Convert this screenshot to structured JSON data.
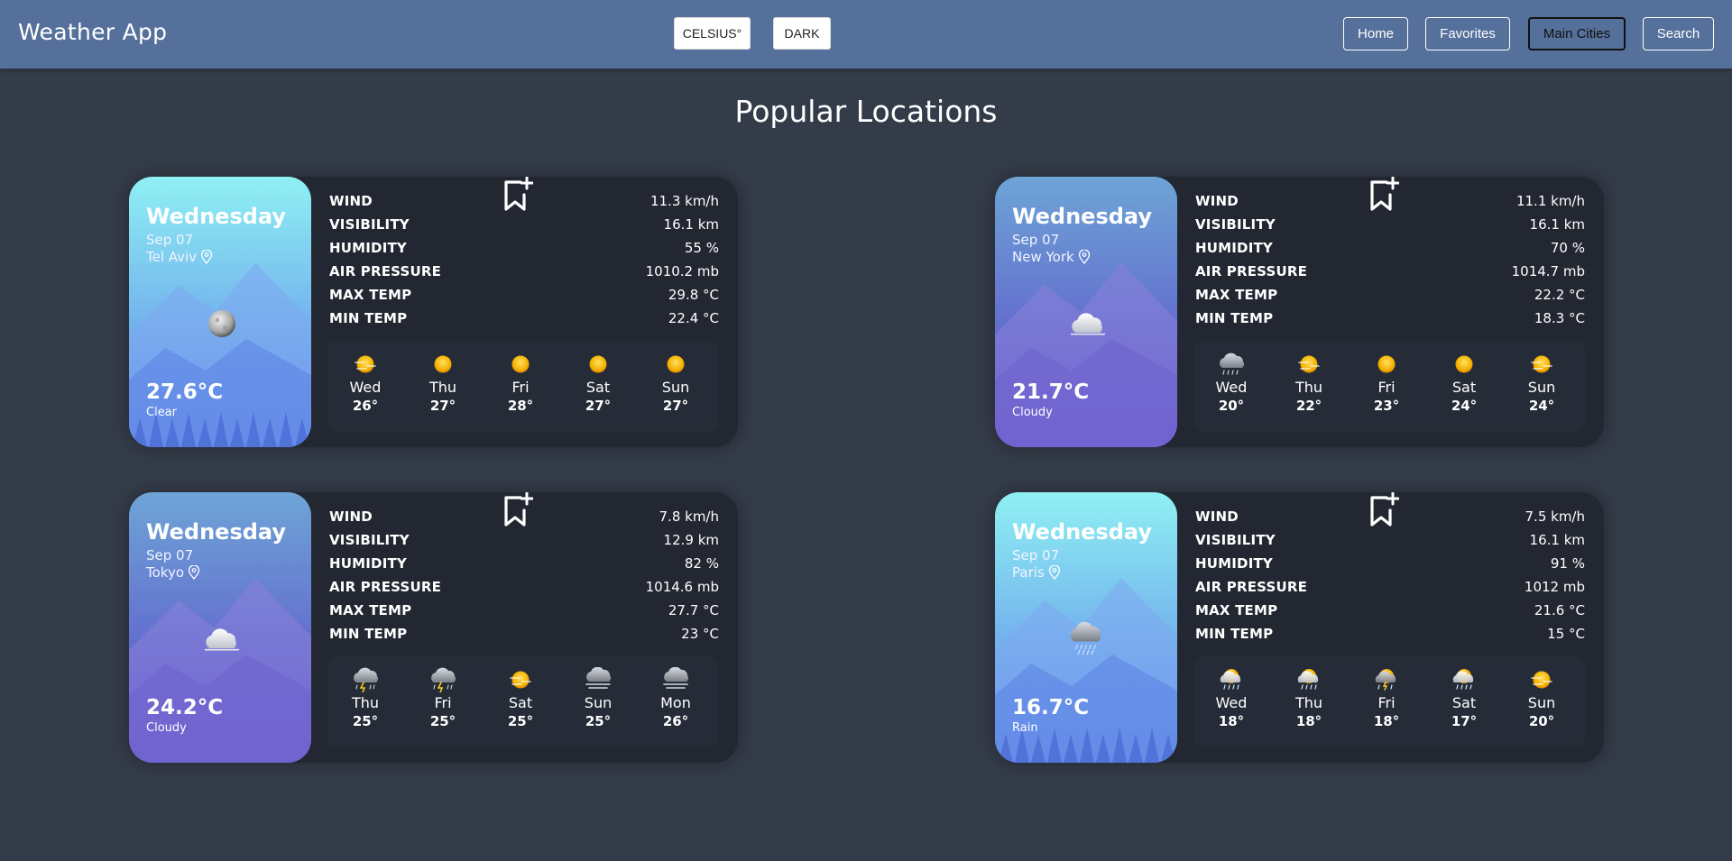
{
  "navbar": {
    "brand": "Weather App",
    "unit_toggle": "CELSIUS°",
    "theme_toggle": "DARK",
    "links": {
      "home": "Home",
      "favorites": "Favorites",
      "main_cities": "Main Cities",
      "search": "Search"
    }
  },
  "page_title": "Popular Locations",
  "stat_labels": {
    "wind": "WIND",
    "visibility": "VISIBILITY",
    "humidity": "HUMIDITY",
    "air_pressure": "AIR PRESSURE",
    "max_temp": "MAX TEMP",
    "min_temp": "MIN TEMP"
  },
  "cards": [
    {
      "day": "Wednesday",
      "date": "Sep 07",
      "city": "Tel Aviv",
      "temp": "27.6°C",
      "condition": "Clear",
      "icon": "moon-icon",
      "theme": "light-blue",
      "stats": {
        "wind": "11.3 km/h",
        "visibility": "16.1 km",
        "humidity": "55 %",
        "air_pressure": "1010.2 mb",
        "max_temp": "29.8 °C",
        "min_temp": "22.4 °C"
      },
      "forecast": [
        {
          "day": "Wed",
          "temp": "26°",
          "icon": "sun-haze-icon"
        },
        {
          "day": "Thu",
          "temp": "27°",
          "icon": "sun-icon"
        },
        {
          "day": "Fri",
          "temp": "28°",
          "icon": "sun-icon"
        },
        {
          "day": "Sat",
          "temp": "27°",
          "icon": "sun-icon"
        },
        {
          "day": "Sun",
          "temp": "27°",
          "icon": "sun-icon"
        }
      ]
    },
    {
      "day": "Wednesday",
      "date": "Sep 07",
      "city": "New York",
      "temp": "21.7°C",
      "condition": "Cloudy",
      "icon": "cloud-icon",
      "theme": "purple",
      "stats": {
        "wind": "11.1 km/h",
        "visibility": "16.1 km",
        "humidity": "70 %",
        "air_pressure": "1014.7 mb",
        "max_temp": "22.2 °C",
        "min_temp": "18.3 °C"
      },
      "forecast": [
        {
          "day": "Wed",
          "temp": "20°",
          "icon": "storm-cloud-icon"
        },
        {
          "day": "Thu",
          "temp": "22°",
          "icon": "sun-haze-icon"
        },
        {
          "day": "Fri",
          "temp": "23°",
          "icon": "sun-icon"
        },
        {
          "day": "Sat",
          "temp": "24°",
          "icon": "sun-icon"
        },
        {
          "day": "Sun",
          "temp": "24°",
          "icon": "sun-haze-icon"
        }
      ]
    },
    {
      "day": "Wednesday",
      "date": "Sep 07",
      "city": "Tokyo",
      "temp": "24.2°C",
      "condition": "Cloudy",
      "icon": "cloud-icon",
      "theme": "purple",
      "stats": {
        "wind": "7.8 km/h",
        "visibility": "12.9 km",
        "humidity": "82 %",
        "air_pressure": "1014.6 mb",
        "max_temp": "27.7 °C",
        "min_temp": "23 °C"
      },
      "forecast": [
        {
          "day": "Thu",
          "temp": "25°",
          "icon": "thunder-cloud-icon"
        },
        {
          "day": "Fri",
          "temp": "25°",
          "icon": "thunder-cloud-icon"
        },
        {
          "day": "Sat",
          "temp": "25°",
          "icon": "sun-haze-icon"
        },
        {
          "day": "Sun",
          "temp": "25°",
          "icon": "fog-cloud-icon"
        },
        {
          "day": "Mon",
          "temp": "26°",
          "icon": "fog-cloud-icon"
        }
      ]
    },
    {
      "day": "Wednesday",
      "date": "Sep 07",
      "city": "Paris",
      "temp": "16.7°C",
      "condition": "Rain",
      "icon": "rain-cloud-icon",
      "theme": "light-blue",
      "stats": {
        "wind": "7.5 km/h",
        "visibility": "16.1 km",
        "humidity": "91 %",
        "air_pressure": "1012 mb",
        "max_temp": "21.6 °C",
        "min_temp": "15 °C"
      },
      "forecast": [
        {
          "day": "Wed",
          "temp": "18°",
          "icon": "sun-rain-icon"
        },
        {
          "day": "Thu",
          "temp": "18°",
          "icon": "sun-rain-icon"
        },
        {
          "day": "Fri",
          "temp": "18°",
          "icon": "sun-storm-icon"
        },
        {
          "day": "Sat",
          "temp": "17°",
          "icon": "sun-rain-icon"
        },
        {
          "day": "Sun",
          "temp": "20°",
          "icon": "sun-haze-icon"
        }
      ]
    }
  ],
  "colors": {
    "navbar": "#55709a",
    "background": "#343c49",
    "card": "#222731",
    "forecast_panel": "#262c37",
    "light_blue_top": "#8ff0f3",
    "light_blue_bottom": "#5b7fe8",
    "purple_top": "#6ea4d6",
    "purple_bottom": "#5a44c8",
    "sun": "#f5b300"
  }
}
